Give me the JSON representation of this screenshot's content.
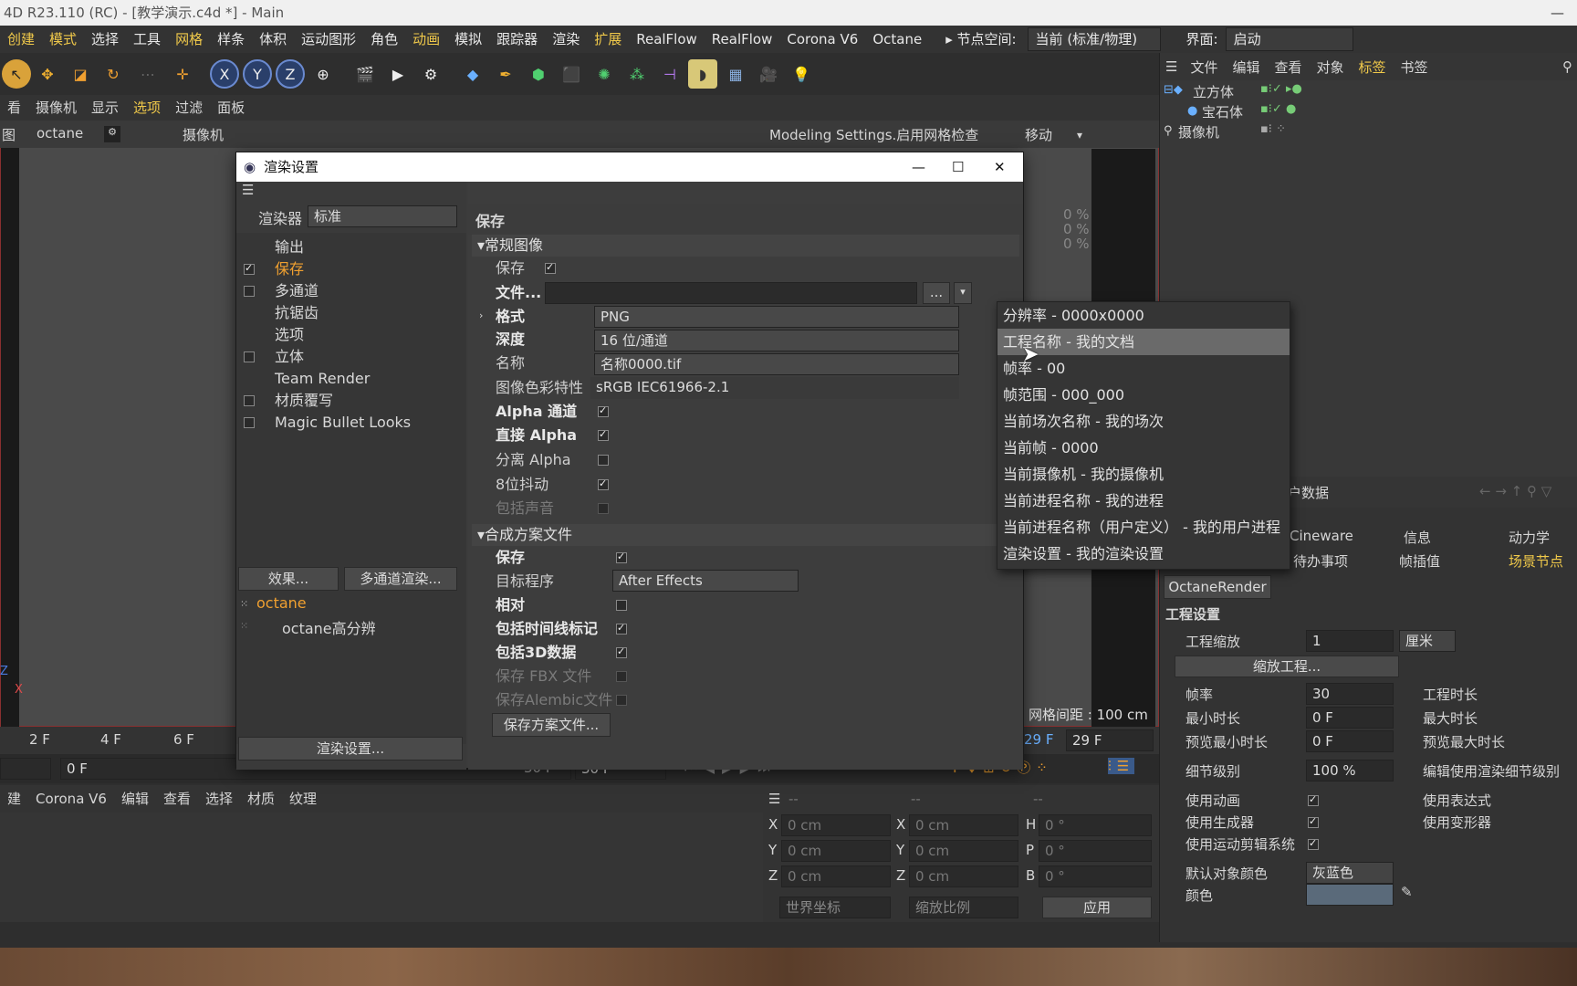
{
  "window": {
    "title": "4D R23.110 (RC) - [教学演示.c4d *] - Main",
    "minimize": "—"
  },
  "menubar": {
    "items": [
      "创建",
      "模式",
      "选择",
      "工具",
      "网格",
      "样条",
      "体积",
      "运动图形",
      "角色",
      "动画",
      "模拟",
      "跟踪器",
      "渲染",
      "扩展",
      "RealFlow",
      "RealFlow",
      "Corona V6",
      "Octane"
    ],
    "node_space_label": "▸ 节点空间:",
    "node_space_value": "当前 (标准/物理)",
    "ui_label": "界面:",
    "ui_value": "启动"
  },
  "toolbar": {
    "x_label": "X",
    "y_label": "Y",
    "z_label": "Z"
  },
  "viewport_menu": [
    "看",
    "摄像机",
    "显示",
    "选项",
    "过滤",
    "面板"
  ],
  "viewport_head": {
    "left": "图",
    "octane": "octane",
    "camera": "摄像机",
    "modeling": "Modeling Settings.启用网格检查",
    "move": "移动",
    "pct1": "0 %",
    "pct2": "0 %",
    "pct3": "0 %",
    "grid": "网格间距 : 100 cm",
    "axis_z": "Z",
    "axis_x": "X"
  },
  "timeline": {
    "ticks": [
      "2 F",
      "4 F",
      "6 F"
    ],
    "frame_left": "0 F",
    "end1": "30 F",
    "end2": "30 F",
    "right1": "29 F",
    "right2": "29 F"
  },
  "bottom_menu": [
    "建",
    "Corona V6",
    "编辑",
    "查看",
    "选择",
    "材质",
    "纹理"
  ],
  "coords": {
    "x1": "X",
    "x1v": "0 cm",
    "x2": "X",
    "x2v": "0 cm",
    "h": "H",
    "hv": "0 °",
    "y1": "Y",
    "y1v": "0 cm",
    "y2": "Y",
    "y2v": "0 cm",
    "p": "P",
    "pv": "0 °",
    "z1": "Z",
    "z1v": "0 cm",
    "z2": "Z",
    "z2v": "0 cm",
    "b": "B",
    "bv": "0 °",
    "world": "世界坐标",
    "scale": "缩放比例",
    "apply": "应用",
    "dash1": "--",
    "dash2": "--",
    "dash3": "--"
  },
  "dialog": {
    "title": "渲染设置",
    "renderer_label": "渲染器",
    "renderer_value": "标准",
    "tree": [
      "输出",
      "保存",
      "多通道",
      "抗锯齿",
      "选项",
      "立体",
      "Team Render",
      "材质覆写",
      "Magic Bullet Looks"
    ],
    "effects_btn": "效果...",
    "multipass_btn": "多通道渲染...",
    "presets": [
      "octane",
      "octane高分辨"
    ],
    "render_settings_btn": "渲染设置...",
    "save_header": "保存",
    "regular_image": "常规图像",
    "save_label": "保存",
    "file_label": "文件...",
    "format_label": "格式",
    "format_value": "PNG",
    "depth_label": "深度",
    "depth_value": "16 位/通道",
    "name_label": "名称",
    "name_value": "名称0000.tif",
    "color_profile_label": "图像色彩特性",
    "color_profile_value": "sRGB IEC61966-2.1",
    "alpha_channel": "Alpha 通道",
    "straight_alpha": "直接 Alpha",
    "separate_alpha": "分离 Alpha",
    "dither": "8位抖动",
    "include_sound": "包括声音",
    "compositing": "合成方案文件",
    "comp_save": "保存",
    "target_app_label": "目标程序",
    "target_app_value": "After Effects",
    "relative": "相对",
    "include_timeline": "包括时间线标记",
    "include_3d": "包括3D数据",
    "save_fbx": "保存 FBX 文件",
    "save_alembic": "保存Alembic文件",
    "save_comp_btn": "保存方案文件...",
    "dots_btn": "..."
  },
  "popup": {
    "items": [
      "分辨率 - 0000x0000",
      "工程名称 - 我的文档",
      "帧率 - 00",
      "帧范围 - 000_000",
      "当前场次名称 - 我的场次",
      "当前帧 - 0000",
      "当前摄像机 - 我的摄像机",
      "当前进程名称 - 我的进程",
      "当前进程名称（用户定义） - 我的用户进程",
      "渲染设置 - 我的渲染设置"
    ],
    "selected_index": 1
  },
  "right_panel": {
    "menu": [
      "文件",
      "编辑",
      "查看",
      "对象",
      "标签",
      "书签"
    ],
    "objects": [
      "立方体",
      "宝石体",
      "摄像机"
    ],
    "user_data": "户数据",
    "tabs1": [
      "Cineware",
      "信息",
      "动力学"
    ],
    "tabs2": [
      "待办事项",
      "帧插值",
      "场景节点"
    ],
    "octane_render": "OctaneRender",
    "project_settings": "工程设置",
    "scale_label": "工程缩放",
    "scale_value": "1",
    "scale_unit": "厘米",
    "scale_btn": "缩放工程...",
    "fps_label": "帧率",
    "fps_value": "30",
    "duration_label": "工程时长",
    "min_time_label": "最小时长",
    "min_time_value": "0 F",
    "max_time_label": "最大时长",
    "preview_min_label": "预览最小时长",
    "preview_min_value": "0 F",
    "preview_max_label": "预览最大时长",
    "lod_label": "细节级别",
    "lod_value": "100 %",
    "lod_render_label": "编辑使用渲染细节级别",
    "use_anim": "使用动画",
    "use_expr": "使用表达式",
    "use_gen": "使用生成器",
    "use_deform": "使用变形器",
    "use_motion": "使用运动剪辑系统",
    "default_color_label": "默认对象颜色",
    "default_color_value": "灰蓝色",
    "color_label": "颜色"
  }
}
